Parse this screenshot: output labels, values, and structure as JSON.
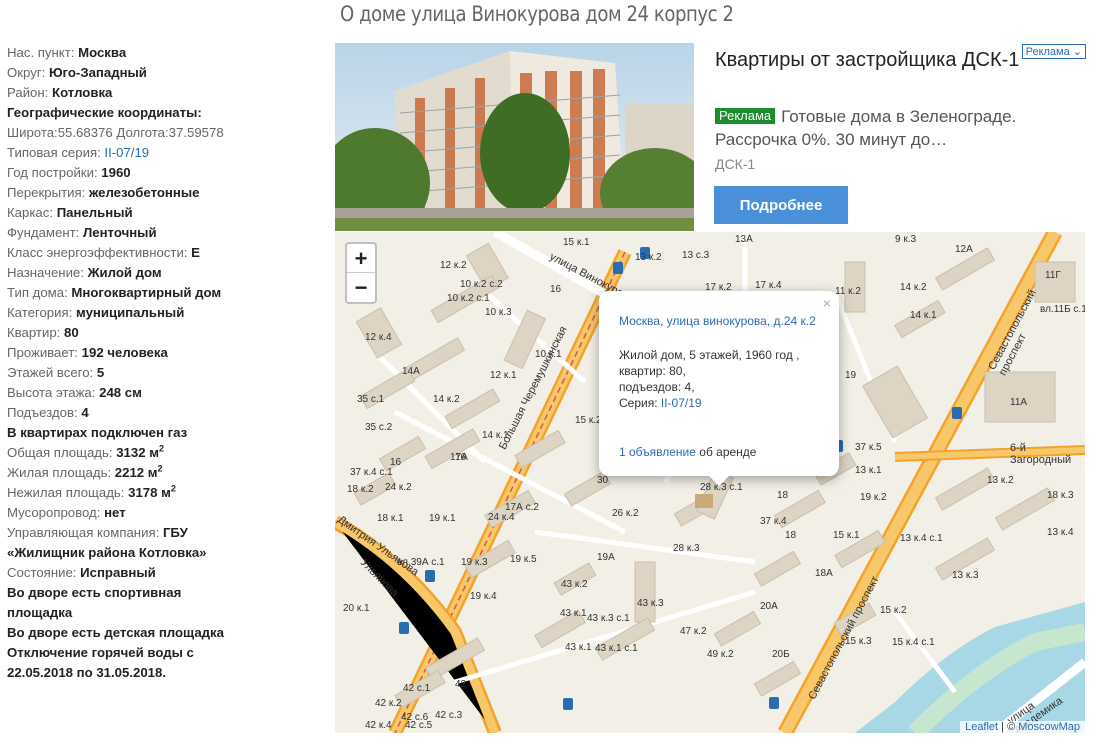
{
  "page_title": "О доме улица Винокурова дом 24 корпус 2",
  "info": {
    "city_label": "Нас. пункт:",
    "city": "Москва",
    "okrug_label": "Округ:",
    "okrug": "Юго-Западный",
    "district_label": "Район:",
    "district": "Котловка",
    "geo_label": "Географические координаты:",
    "coords": "Широта:55.68376 Долгота:37.59578",
    "series_label": "Типовая серия:",
    "series": "II-07/19",
    "year_label": "Год постройки:",
    "year": "1960",
    "floors_type_label": "Перекрытия:",
    "floors_type": "железобетонные",
    "frame_label": "Каркас:",
    "frame": "Панельный",
    "foundation_label": "Фундамент:",
    "foundation": "Ленточный",
    "energy_label": "Класс энергоэффективности:",
    "energy": "E",
    "purpose_label": "Назначение:",
    "purpose": "Жилой дом",
    "house_type_label": "Тип дома:",
    "house_type": "Многоквартирный дом",
    "category_label": "Категория:",
    "category": "муниципальный",
    "apartments_label": "Квартир:",
    "apartments": "80",
    "residents_label": "Проживает:",
    "residents": "192 человека",
    "floors_label": "Этажей всего:",
    "floors": "5",
    "height_label": "Высота этажа:",
    "height": "248 см",
    "entrances_label": "Подъездов:",
    "entrances": "4",
    "gas": "В квартирах подключен газ",
    "total_area_label": "Общая площадь:",
    "total_area": "3132 м",
    "living_area_label": "Жилая площадь:",
    "living_area": "2212 м",
    "nonliving_area_label": "Нежилая площадь:",
    "nonliving_area": "3178 м",
    "area_sup": "2",
    "chute_label": "Мусоропровод:",
    "chute": "нет",
    "company_label": "Управляющая компания:",
    "company_a": "ГБУ",
    "company_b": "«Жилищник района Котловка»",
    "state_label": "Состояние:",
    "state": "Исправный",
    "sport": "Во дворе есть спортивная площадка",
    "kids": "Во дворе есть детская площадка",
    "water": "Отключение горячей воды с 22.05.2018 по 31.05.2018."
  },
  "ad": {
    "badge": "Реклама ⌄",
    "title": "Квартиры от застройщика ДСК-1",
    "tag": "Реклама",
    "text": "Готовые дома в Зеленограде. Рассрочка 0%. 30 минут до…",
    "source": "ДСК-1",
    "button": "Подробнее"
  },
  "map": {
    "zoom_in": "+",
    "zoom_out": "−",
    "popup": {
      "close": "×",
      "address": "Москва, улица винокурова, д.24 к.2",
      "line1": "Жилой дом, 5 этажей, 1960 год ,",
      "line2": "квартир: 80,",
      "line3": "подъездов: 4,",
      "series_label": "Серия: ",
      "series": "II-07/19",
      "ads_link": "1 объявление",
      "ads_text": " об аренде"
    },
    "attr_leaflet": "Leaflet",
    "attr_sep": " | © ",
    "attr_map": "MoscowMap",
    "streets": {
      "vinokurova": "улица Винокурова",
      "cheremushkinskaya": "Большая Черемушкинская",
      "sevastopolsky_n": "Севастопольский проспект",
      "sevastopolsky_s": "Севастопольский проспект",
      "zagorodny": "6-й Загородный",
      "akademika": "улица Академика",
      "ulyanova": "Дмитрия Ульянова",
      "ulyanova2": "Ульянова"
    },
    "labels": [
      "15 к.1",
      "13 к.2",
      "13 с.3",
      "13А",
      "9 к.3",
      "12А",
      "11Г",
      "12 к.2",
      "10 к.2 с.2",
      "10 к.2 с.1",
      "16",
      "10 к.3",
      "17 к.2",
      "17 к.4",
      "11 к.2",
      "14 к.2",
      "14 к.1",
      "вл.11Б с.1",
      "12 к.4",
      "10 к.1",
      "14А",
      "12 к.1",
      "19",
      "11А",
      "35 с.1",
      "14 к.2",
      "35 с.2",
      "14 к.1",
      "15 к.2",
      "16",
      "37 к.5",
      "37 к.4 с.1",
      "16",
      "17А",
      "30",
      "13 к.1",
      "13 к.2",
      "18 к.3",
      "18 к.2",
      "24 к.2",
      "28 к.3 с.1",
      "18",
      "19 к.2",
      "17А с.2",
      "26 к.2",
      "37 к.4",
      "18 к.1",
      "19 к.1",
      "24 к.4",
      "28 к.3",
      "18",
      "15 к.1",
      "13 к.4 с.1",
      "13 к.4",
      "вл.39А с.1",
      "19А",
      "19 к.3",
      "19 к.5",
      "18А",
      "13 к.3",
      "43 к.2",
      "20 к.1",
      "19 к.4",
      "43 к.3",
      "20А",
      "15 к.2",
      "43 к.1",
      "43 к.3 с.1",
      "47 к.2",
      "15 к.3",
      "15 к.4 с.1",
      "43 к.1",
      "43 к.1 с.1",
      "49 к.2",
      "20Б",
      "42 с.1",
      "42",
      "42 к.2",
      "42 с.6",
      "42 с.3",
      "42 с.5",
      "42 к.4"
    ]
  }
}
